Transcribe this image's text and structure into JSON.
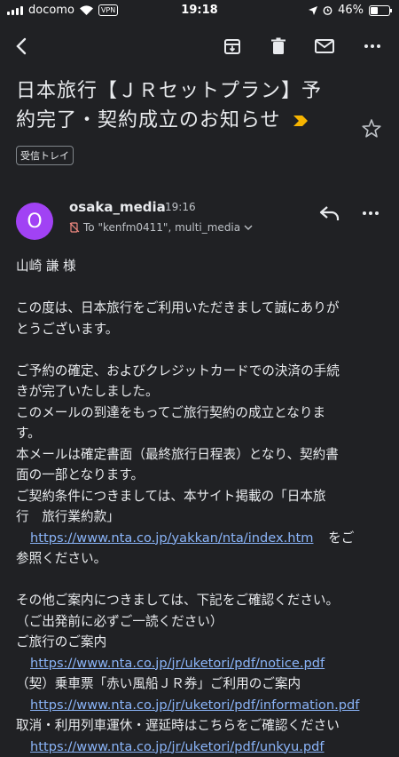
{
  "status": {
    "carrier": "docomo",
    "vpn": "VPN",
    "time": "19:18",
    "battery": "46%",
    "battery_level": 0.46
  },
  "toolbar": {
    "back": "back-arrow-icon",
    "archive": "archive-icon",
    "delete": "trash-icon",
    "mark_unread": "mail-icon",
    "more": "more-vert-icon"
  },
  "email": {
    "subject_line1": "日本旅行【ＪＲセットプラン】予",
    "subject_line2": "約完了・契約成立のお知らせ",
    "label": "受信トレイ",
    "sender": "osaka_media",
    "time": "19:16",
    "to": "To \"kenfm0411\", multi_media"
  },
  "body": {
    "greeting": "山崎 謙 様",
    "p1_l1": "この度は、日本旅行をご利用いただきまして誠にありが",
    "p1_l2": "とうございます。",
    "p2_l1": "ご予約の確定、およびクレジットカードでの決済の手続",
    "p2_l2": "きが完了いたしました。",
    "p2_l3": "このメールの到達をもってご旅行契約の成立となりま",
    "p2_l4": "す。",
    "p2_l5": "本メールは確定書面（最終旅行日程表）となり、契約書",
    "p2_l6": "面の一部となります。",
    "p2_l7": "ご契約条件につきましては、本サイト掲載の「日本旅",
    "p2_l8": "行　旅行業約款」",
    "link1": "https://www.nta.co.jp/yakkan/nta/index.htm",
    "link1_suffix": "をご",
    "p2_l10": "参照ください。",
    "p3_l1": "その他ご案内につきましては、下記をご確認ください。",
    "p3_l2": "（ご出発前に必ずご一読ください）",
    "p3_l3": "ご旅行のご案内",
    "link2": "https://www.nta.co.jp/jr/uketori/pdf/notice.pdf",
    "p3_l5": "（契）乗車票「赤い風船ＪＲ券」ご利用のご案内",
    "link3": "https://www.nta.co.jp/jr/uketori/pdf/information.pdf",
    "p3_l7": "取消・利用列車運休・遅延時はこちらをご確認ください",
    "link4": "https://www.nta.co.jp/jr/uketori/pdf/unkyu.pdf"
  }
}
